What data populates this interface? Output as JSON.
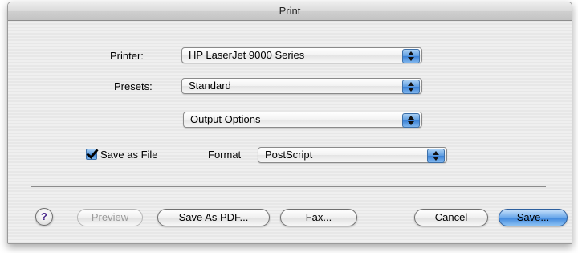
{
  "window": {
    "title": "Print"
  },
  "printer": {
    "label": "Printer:",
    "value": "HP LaserJet 9000 Series"
  },
  "presets": {
    "label": "Presets:",
    "value": "Standard"
  },
  "panel": {
    "value": "Output Options"
  },
  "save_as_file": {
    "label": "Save as File",
    "checked": true
  },
  "format": {
    "label": "Format",
    "value": "PostScript"
  },
  "buttons": {
    "help": "?",
    "preview": "Preview",
    "save_as_pdf": "Save As PDF...",
    "fax": "Fax...",
    "cancel": "Cancel",
    "save": "Save..."
  },
  "colors": {
    "accent_blue": "#3d86dc"
  }
}
